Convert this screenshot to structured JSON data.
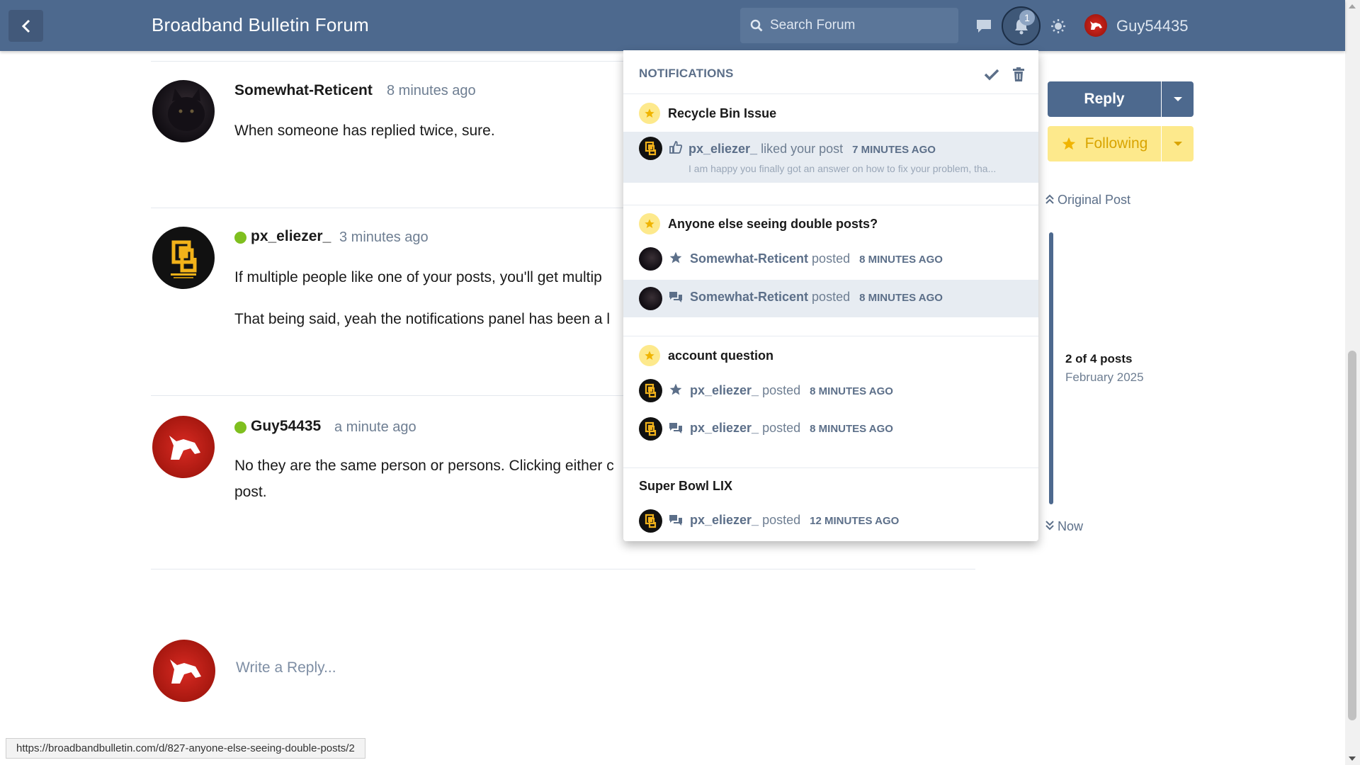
{
  "header": {
    "title": "Broadband Bulletin Forum",
    "search_placeholder": "Search Forum",
    "notification_count": "1",
    "username": "Guy54435"
  },
  "posts": [
    {
      "author": "Somewhat-Reticent",
      "time": "8 minutes ago",
      "paragraphs": [
        "When someone has replied twice, sure."
      ]
    },
    {
      "author": "px_eliezer_",
      "time": "3 minutes ago",
      "paragraphs": [
        "If multiple people like one of your posts, you'll get multip",
        "That being said, yeah the notifications panel has been a l"
      ]
    },
    {
      "author": "Guy54435",
      "time": "a minute ago",
      "paragraphs": [
        "No they are the same person or persons. Clicking either c",
        "post."
      ]
    }
  ],
  "composer": {
    "placeholder": "Write a Reply..."
  },
  "sidebar": {
    "reply_label": "Reply",
    "following_label": "Following",
    "original_post": "Original Post",
    "position": "2 of 4 posts",
    "date": "February 2025",
    "now": "Now"
  },
  "notifications": {
    "heading": "NOTIFICATIONS",
    "groups": [
      {
        "title": "Recycle Bin Issue",
        "items": [
          {
            "user": "px_eliezer_",
            "action": "liked your post",
            "time": "7 minutes ago",
            "icon": "thumbs-up-icon",
            "excerpt": "I am happy you finally got an answer on how to fix your problem, tha..."
          }
        ]
      },
      {
        "title": "Anyone else seeing double posts?",
        "items": [
          {
            "user": "Somewhat-Reticent",
            "action": "posted",
            "time": "8 minutes ago",
            "icon": "star-icon"
          },
          {
            "user": "Somewhat-Reticent",
            "action": "posted",
            "time": "8 minutes ago",
            "icon": "comments-icon"
          }
        ]
      },
      {
        "title": "account question",
        "items": [
          {
            "user": "px_eliezer_",
            "action": "posted",
            "time": "8 minutes ago",
            "icon": "star-icon"
          },
          {
            "user": "px_eliezer_",
            "action": "posted",
            "time": "8 minutes ago",
            "icon": "comments-icon"
          }
        ]
      },
      {
        "title": "Super Bowl LIX",
        "items": [
          {
            "user": "px_eliezer_",
            "action": "posted",
            "time": "12 minutes ago",
            "icon": "comments-icon"
          }
        ]
      }
    ]
  },
  "status_bar": {
    "url": "https://broadbandbulletin.com/d/827-anyone-else-seeing-double-posts/2"
  },
  "colors": {
    "header": "#4d698e",
    "accent": "#5c6f89",
    "following": "#fde98c",
    "online": "#7fbf1f"
  }
}
